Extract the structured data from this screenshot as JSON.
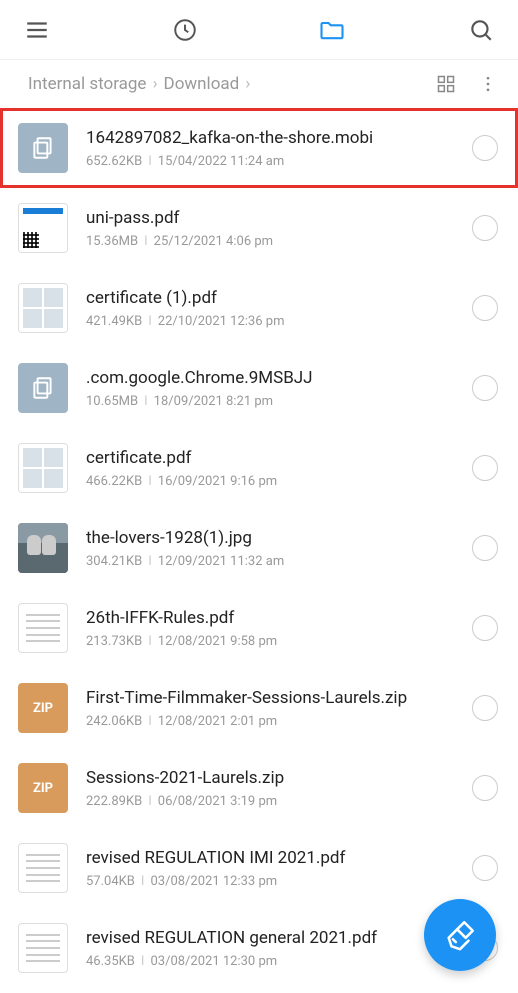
{
  "breadcrumb": {
    "root": "Internal storage",
    "folder": "Download"
  },
  "files": [
    {
      "name": "1642897082_kafka-on-the-shore.mobi",
      "size": "652.62KB",
      "date": "15/04/2022 11:24 am",
      "thumb": "generic",
      "highlighted": true
    },
    {
      "name": "uni-pass.pdf",
      "size": "15.36MB",
      "date": "25/12/2021 4:06 pm",
      "thumb": "unipass"
    },
    {
      "name": "certificate (1).pdf",
      "size": "421.49KB",
      "date": "22/10/2021 12:36 pm",
      "thumb": "cert"
    },
    {
      "name": ".com.google.Chrome.9MSBJJ",
      "size": "10.65MB",
      "date": "18/09/2021 8:21 pm",
      "thumb": "generic"
    },
    {
      "name": "certificate.pdf",
      "size": "466.22KB",
      "date": "16/09/2021 9:16 pm",
      "thumb": "cert"
    },
    {
      "name": "the-lovers-1928(1).jpg",
      "size": "304.21KB",
      "date": "12/09/2021 11:32 am",
      "thumb": "lovers"
    },
    {
      "name": "26th-IFFK-Rules.pdf",
      "size": "213.73KB",
      "date": "12/08/2021 9:58 pm",
      "thumb": "doc"
    },
    {
      "name": "First-Time-Filmmaker-Sessions-Laurels.zip",
      "size": "242.06KB",
      "date": "12/08/2021 2:01 pm",
      "thumb": "zip",
      "zipLabel": "ZIP"
    },
    {
      "name": "Sessions-2021-Laurels.zip",
      "size": "222.89KB",
      "date": "06/08/2021 3:19 pm",
      "thumb": "zip",
      "zipLabel": "ZIP"
    },
    {
      "name": "revised REGULATION IMI 2021.pdf",
      "size": "57.04KB",
      "date": "03/08/2021 12:33 pm",
      "thumb": "doc"
    },
    {
      "name": "revised REGULATION general 2021.pdf",
      "size": "46.35KB",
      "date": "03/08/2021 12:30 pm",
      "thumb": "doc"
    }
  ]
}
